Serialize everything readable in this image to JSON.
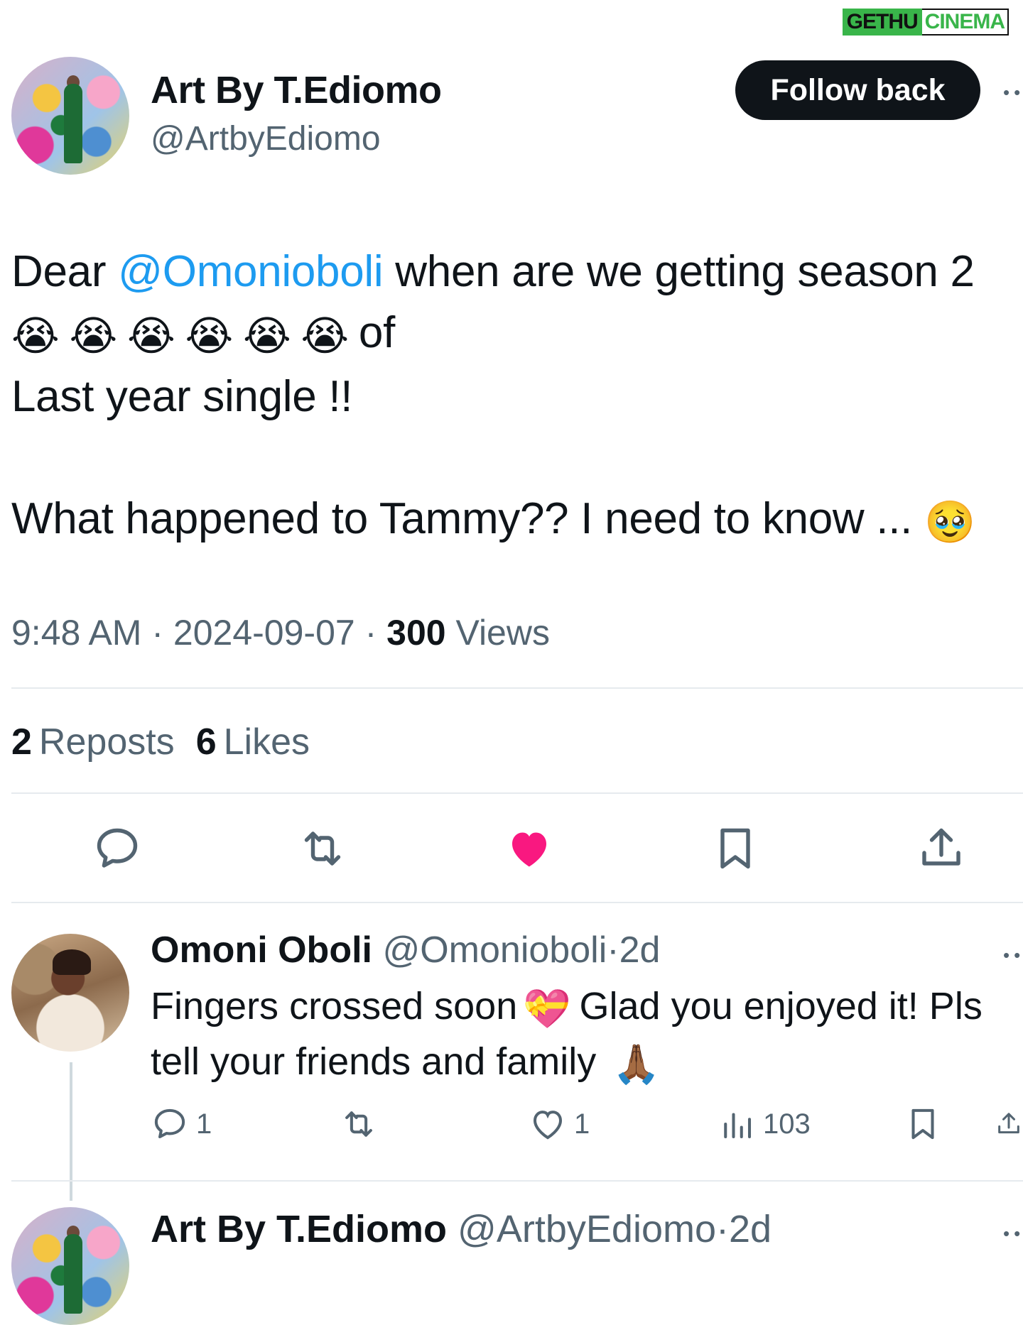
{
  "watermark": {
    "part1": "GETHU",
    "part2": "CINEMA"
  },
  "tweet": {
    "author_name": "Art By T.Ediomo",
    "author_handle": "@ArtbyEdiomo",
    "follow_label": "Follow back",
    "line1_pre": "Dear ",
    "mention": "@Omonioboli",
    "line1_post": " when are we getting season 2",
    "emoji_crying": "😭",
    "line2_post": "of",
    "line3": "Last year single !!",
    "line4": "What happened to Tammy?? I need to know ...",
    "emoji_pleading": "🥹",
    "time": "9:48 AM",
    "date": "2024-09-07",
    "views_count": "300",
    "views_label": "Views",
    "reposts_count": "2",
    "reposts_label": "Reposts",
    "likes_count": "6",
    "likes_label": "Likes",
    "like_color": "#f91880"
  },
  "reply": {
    "name": "Omoni Oboli",
    "handle": "@Omonioboli",
    "age": "2d",
    "line1_pre": "Fingers crossed soon",
    "emoji_heart": "💝",
    "line1_post": "Glad you enjoyed it! Pls",
    "line2": "tell your friends and family",
    "emoji_pray": "🙏🏾",
    "replies": "1",
    "likes": "1",
    "views": "103"
  },
  "reply2": {
    "name": "Art By T.Ediomo",
    "handle": "@ArtbyEdiomo",
    "age": "2d"
  },
  "separator": "·",
  "more_glyph": "••"
}
